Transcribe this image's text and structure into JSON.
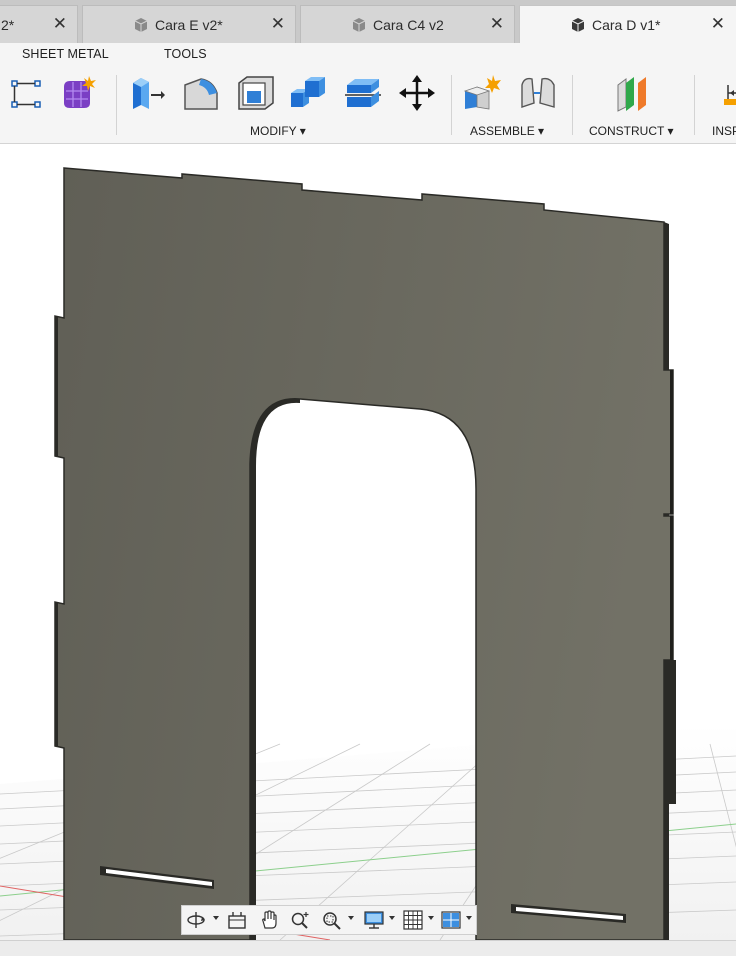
{
  "tabs": [
    {
      "label": "2*",
      "active": false
    },
    {
      "label": "Cara E v2*",
      "active": false
    },
    {
      "label": "Cara C4 v2",
      "active": false
    },
    {
      "label": "Cara D v1*",
      "active": true
    }
  ],
  "tab_close_glyph": "✕",
  "ribbon": {
    "tabs": [
      "SHEET METAL",
      "TOOLS"
    ],
    "groups": {
      "modify": "MODIFY ▾",
      "assemble": "ASSEMBLE ▾",
      "construct": "CONSTRUCT ▾",
      "inspect": "INSP"
    },
    "tools": [
      "sketch-dimension-icon",
      "create-form-icon",
      "press-pull-icon",
      "fillet-icon",
      "shell-icon",
      "combine-icon",
      "split-face-icon",
      "move-icon",
      "new-component-icon",
      "joint-icon",
      "offset-plane-icon",
      "measure-icon"
    ]
  },
  "navbar": {
    "tools": [
      "orbit-icon",
      "look-at-icon",
      "pan-icon",
      "zoom-icon",
      "fit-icon",
      "display-settings-icon",
      "grid-icon",
      "viewports-icon"
    ]
  },
  "colors": {
    "part_face": "#6e6d63",
    "part_edge": "#2a2a26",
    "tab_bg": "#d6d6d6",
    "tab_active_bg": "#f5f5f5",
    "ribbon_bg": "#f5f5f5"
  }
}
